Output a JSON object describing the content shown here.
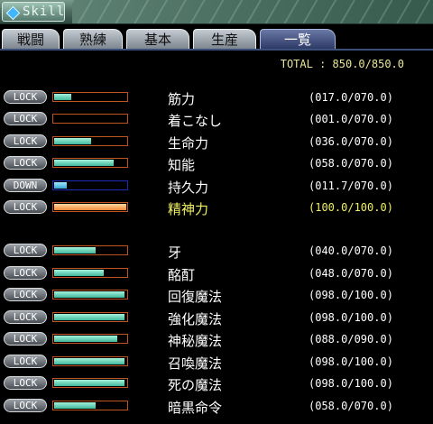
{
  "window": {
    "title": "Skill"
  },
  "tabs": [
    {
      "label": "戦闘",
      "active": false
    },
    {
      "label": "熟練",
      "active": false
    },
    {
      "label": "基本",
      "active": false
    },
    {
      "label": "生産",
      "active": false
    },
    {
      "label": "一覧",
      "active": true
    }
  ],
  "total": "TOTAL : 850.0/850.0",
  "skills": [
    {
      "lock": "LOCK",
      "name": "筋力",
      "value": "(017.0/070.0)",
      "fraction": 0.24
    },
    {
      "lock": "LOCK",
      "name": "着こなし",
      "value": "(001.0/070.0)",
      "fraction": 0.0
    },
    {
      "lock": "LOCK",
      "name": "生命力",
      "value": "(036.0/070.0)",
      "fraction": 0.51
    },
    {
      "lock": "LOCK",
      "name": "知能",
      "value": "(058.0/070.0)",
      "fraction": 0.83
    },
    {
      "lock": "DOWN",
      "name": "持久力",
      "value": "(011.7/070.0)",
      "fraction": 0.17
    },
    {
      "lock": "LOCK",
      "name": "精神力",
      "value": "(100.0/100.0)",
      "fraction": 1.0,
      "highlight": true
    },
    {
      "lock": "LOCK",
      "name": "牙",
      "value": "(040.0/070.0)",
      "fraction": 0.57
    },
    {
      "lock": "LOCK",
      "name": "酩酊",
      "value": "(048.0/070.0)",
      "fraction": 0.69
    },
    {
      "lock": "LOCK",
      "name": "回復魔法",
      "value": "(098.0/100.0)",
      "fraction": 0.98
    },
    {
      "lock": "LOCK",
      "name": "強化魔法",
      "value": "(098.0/100.0)",
      "fraction": 0.98
    },
    {
      "lock": "LOCK",
      "name": "神秘魔法",
      "value": "(088.0/090.0)",
      "fraction": 0.88
    },
    {
      "lock": "LOCK",
      "name": "召喚魔法",
      "value": "(098.0/100.0)",
      "fraction": 0.98
    },
    {
      "lock": "LOCK",
      "name": "死の魔法",
      "value": "(098.0/100.0)",
      "fraction": 0.98
    },
    {
      "lock": "LOCK",
      "name": "暗黒命令",
      "value": "(058.0/070.0)",
      "fraction": 0.58
    }
  ]
}
